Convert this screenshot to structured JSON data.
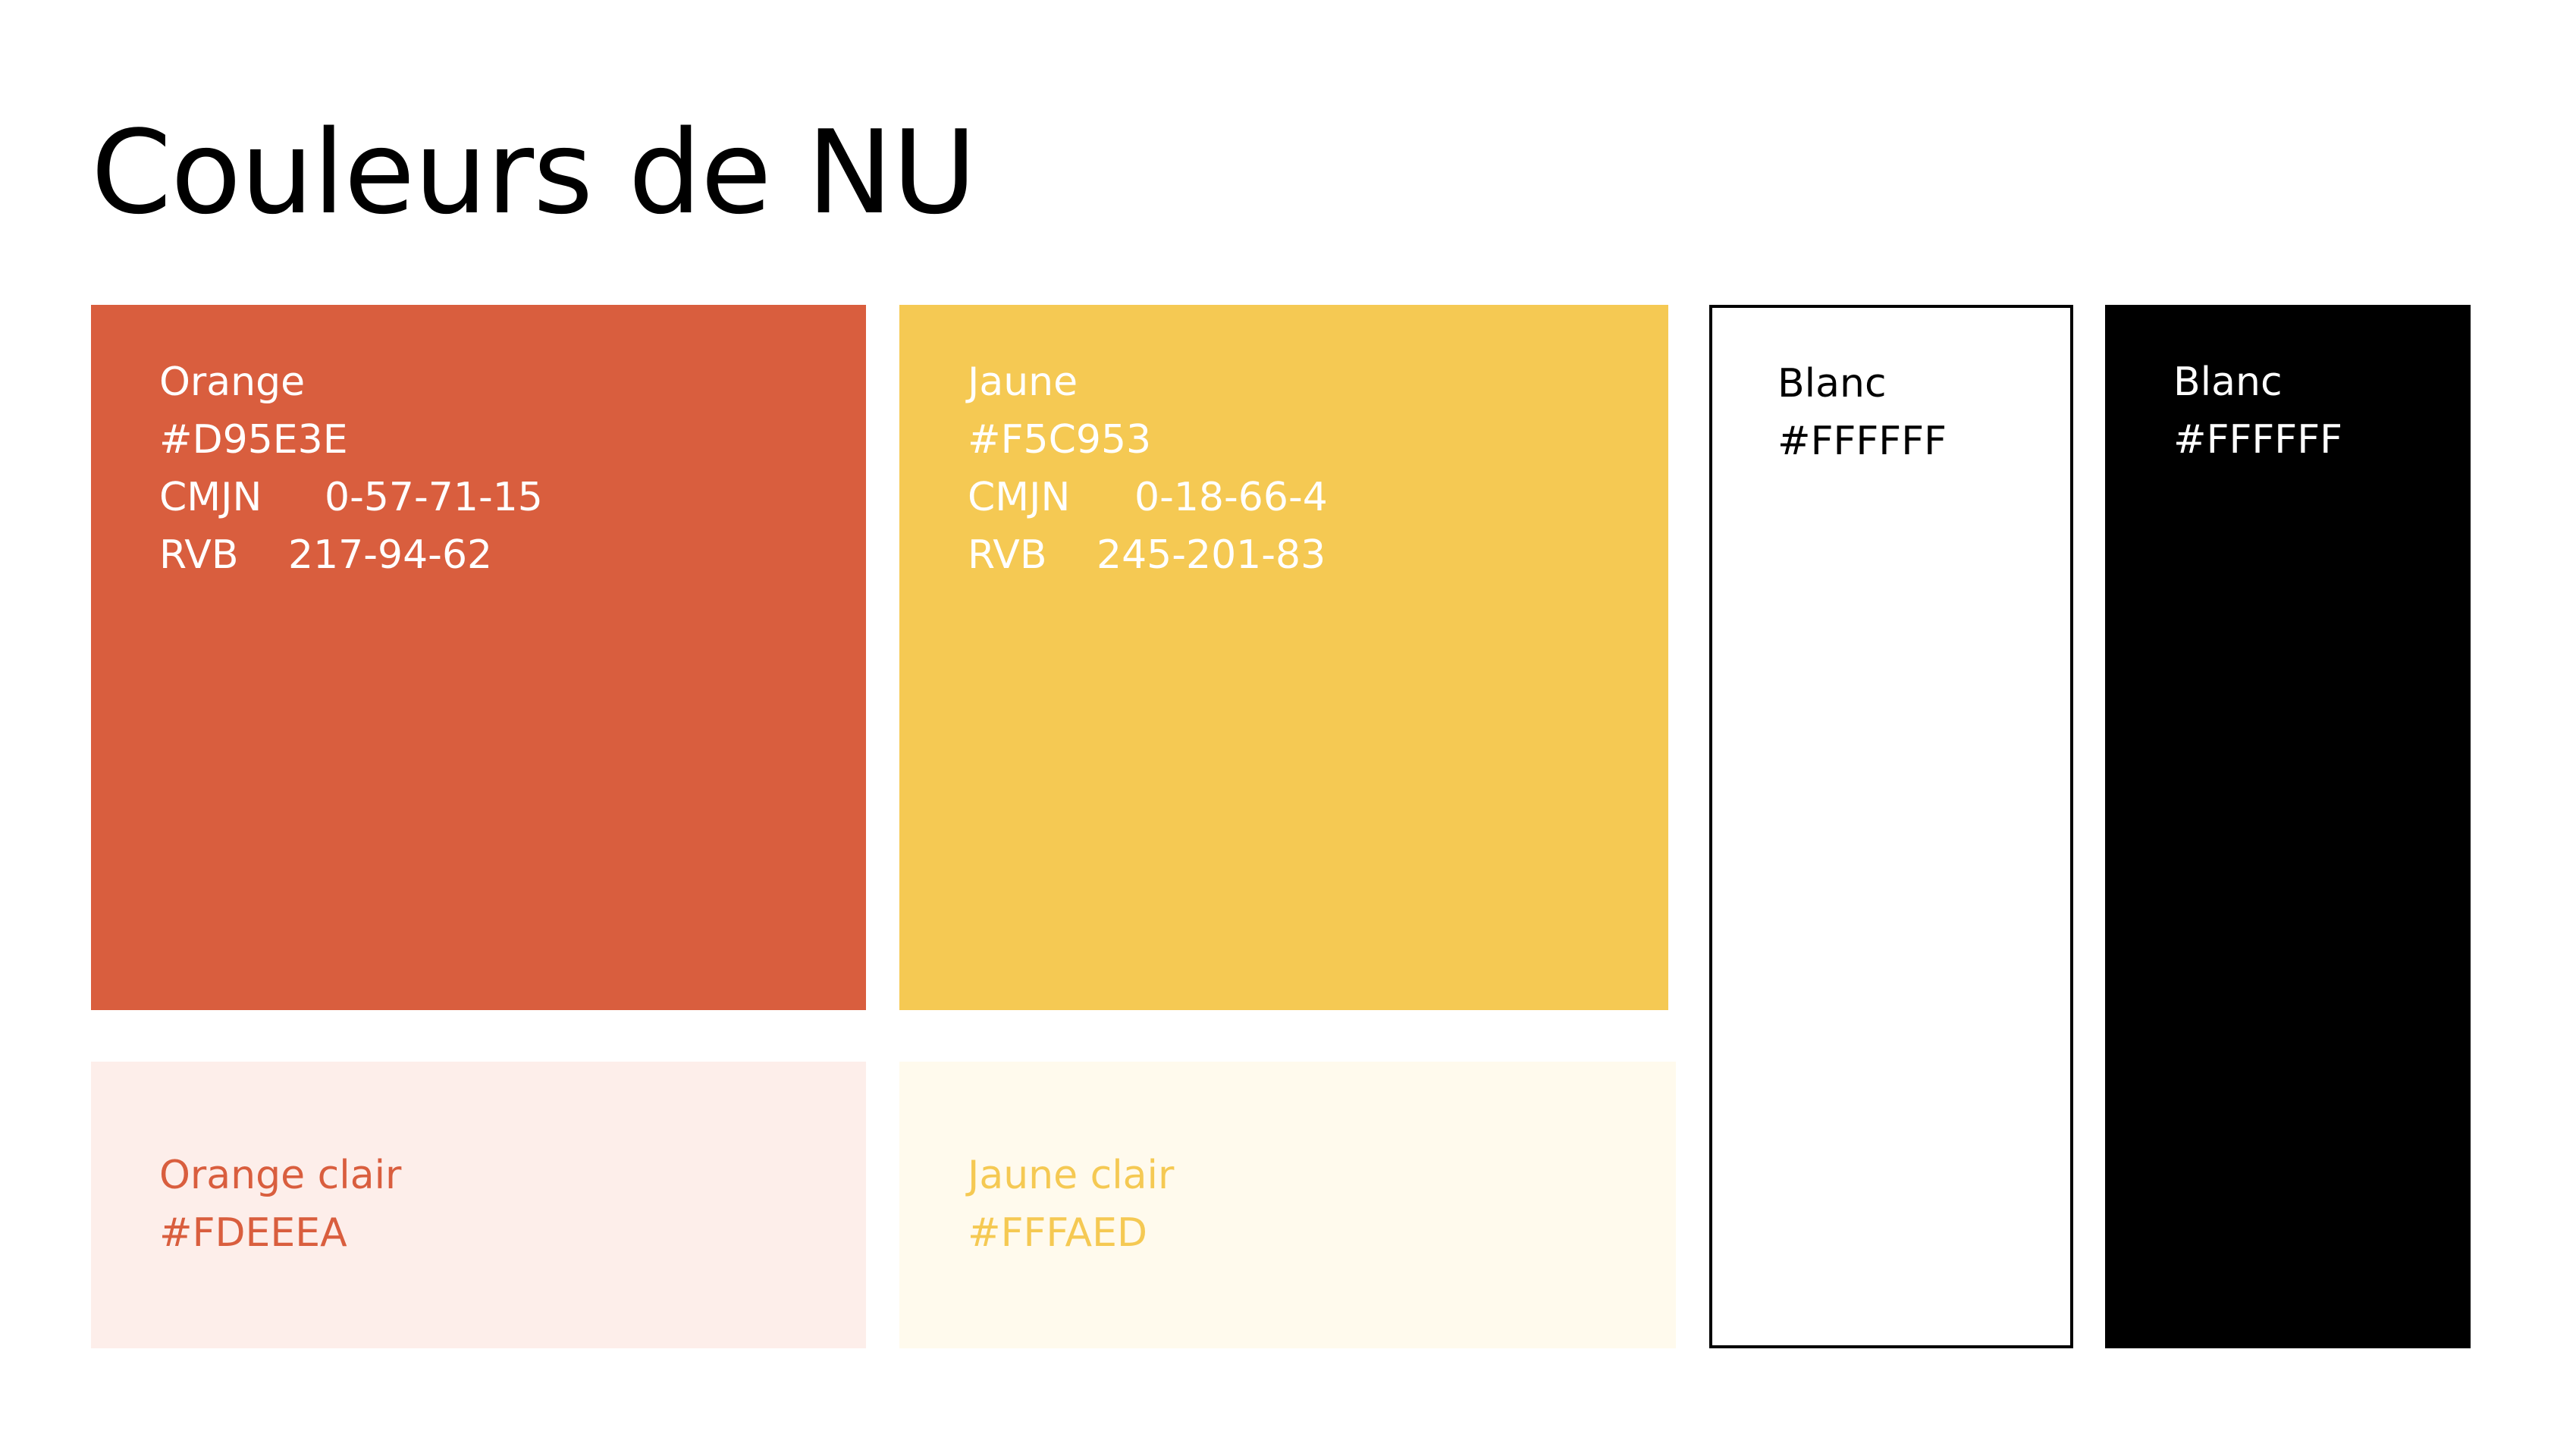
{
  "page": {
    "title": "Couleurs de NU"
  },
  "swatches": {
    "orange": {
      "name": "Orange",
      "hex": "#D95E3E",
      "cmjn_label": "CMJN",
      "cmjn_value": "0-57-71-15",
      "rvb_label": "RVB",
      "rvb_value": "217-94-62",
      "color": "#D95E3E"
    },
    "jaune": {
      "name": "Jaune",
      "hex": "#F5C953",
      "cmjn_label": "CMJN",
      "cmjn_value": "0-18-66-4",
      "rvb_label": "RVB",
      "rvb_value": "245-201-83",
      "color": "#F5C953"
    },
    "orange_clair": {
      "name": "Orange clair",
      "hex": "#FDEEEA",
      "color": "#FDEEEA",
      "text_color": "#D95E3E"
    },
    "jaune_clair": {
      "name": "Jaune clair",
      "hex": "#FFFAED",
      "color": "#FFFAED",
      "text_color": "#F5C953"
    },
    "blanc": {
      "name": "Blanc",
      "hex": "#FFFFFF",
      "color": "#FFFFFF",
      "border_color": "#000000"
    },
    "noir": {
      "name": "Blanc",
      "hex": "#FFFFFF",
      "color": "#000000",
      "text_color": "#FFFFFF"
    }
  }
}
